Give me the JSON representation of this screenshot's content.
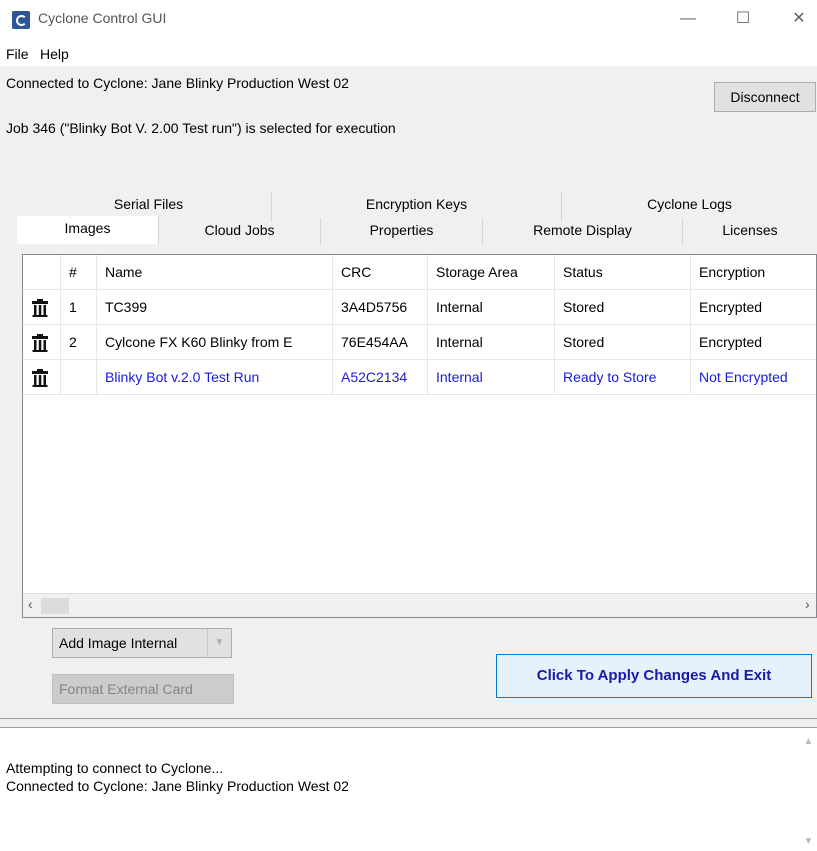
{
  "window": {
    "title": "Cyclone Control GUI",
    "minimize": "—",
    "maximize": "☐",
    "close": "✕"
  },
  "menu": {
    "file": "File",
    "help": "Help"
  },
  "connection": {
    "status": "Connected to Cyclone: Jane Blinky Production West 02",
    "job": "Job 346 (\"Blinky Bot V. 2.00 Test run\") is selected for execution",
    "disconnect_label": "Disconnect"
  },
  "tabs_top": [
    "Serial Files",
    "Encryption Keys",
    "Cyclone Logs"
  ],
  "tabs_bottom": [
    "Images",
    "Cloud Jobs",
    "Properties",
    "Remote Display",
    "Licenses"
  ],
  "selected_tab": "Images",
  "table": {
    "headers": [
      "#",
      "Name",
      "CRC",
      "Storage Area",
      "Status",
      "Encryption"
    ],
    "rows": [
      {
        "num": "1",
        "name": "TC399",
        "crc": "3A4D5756",
        "storage": "Internal",
        "status": "Stored",
        "encryption": "Encrypted",
        "pending": false
      },
      {
        "num": "2",
        "name": "Cylcone FX K60 Blinky from E",
        "crc": "76E454AA",
        "storage": "Internal",
        "status": "Stored",
        "encryption": "Encrypted",
        "pending": false
      },
      {
        "num": "",
        "name": "Blinky Bot v.2.0 Test Run",
        "crc": "A52C2134",
        "storage": "Internal",
        "status": "Ready to Store",
        "encryption": "Not Encrypted",
        "pending": true
      }
    ]
  },
  "scroll": {
    "left": "‹",
    "right": "›"
  },
  "buttons": {
    "add_image": "Add Image Internal",
    "format_card": "Format External Card",
    "apply": "Click To Apply Changes And Exit"
  },
  "log": {
    "lines": [
      "Attempting to connect to Cyclone...",
      "Connected to Cyclone: Jane Blinky Production West 02"
    ]
  },
  "colors": {
    "pending_text": "#1a1adc",
    "apply_text": "#1a1aa6",
    "panel_bg": "#f0f0f0"
  }
}
